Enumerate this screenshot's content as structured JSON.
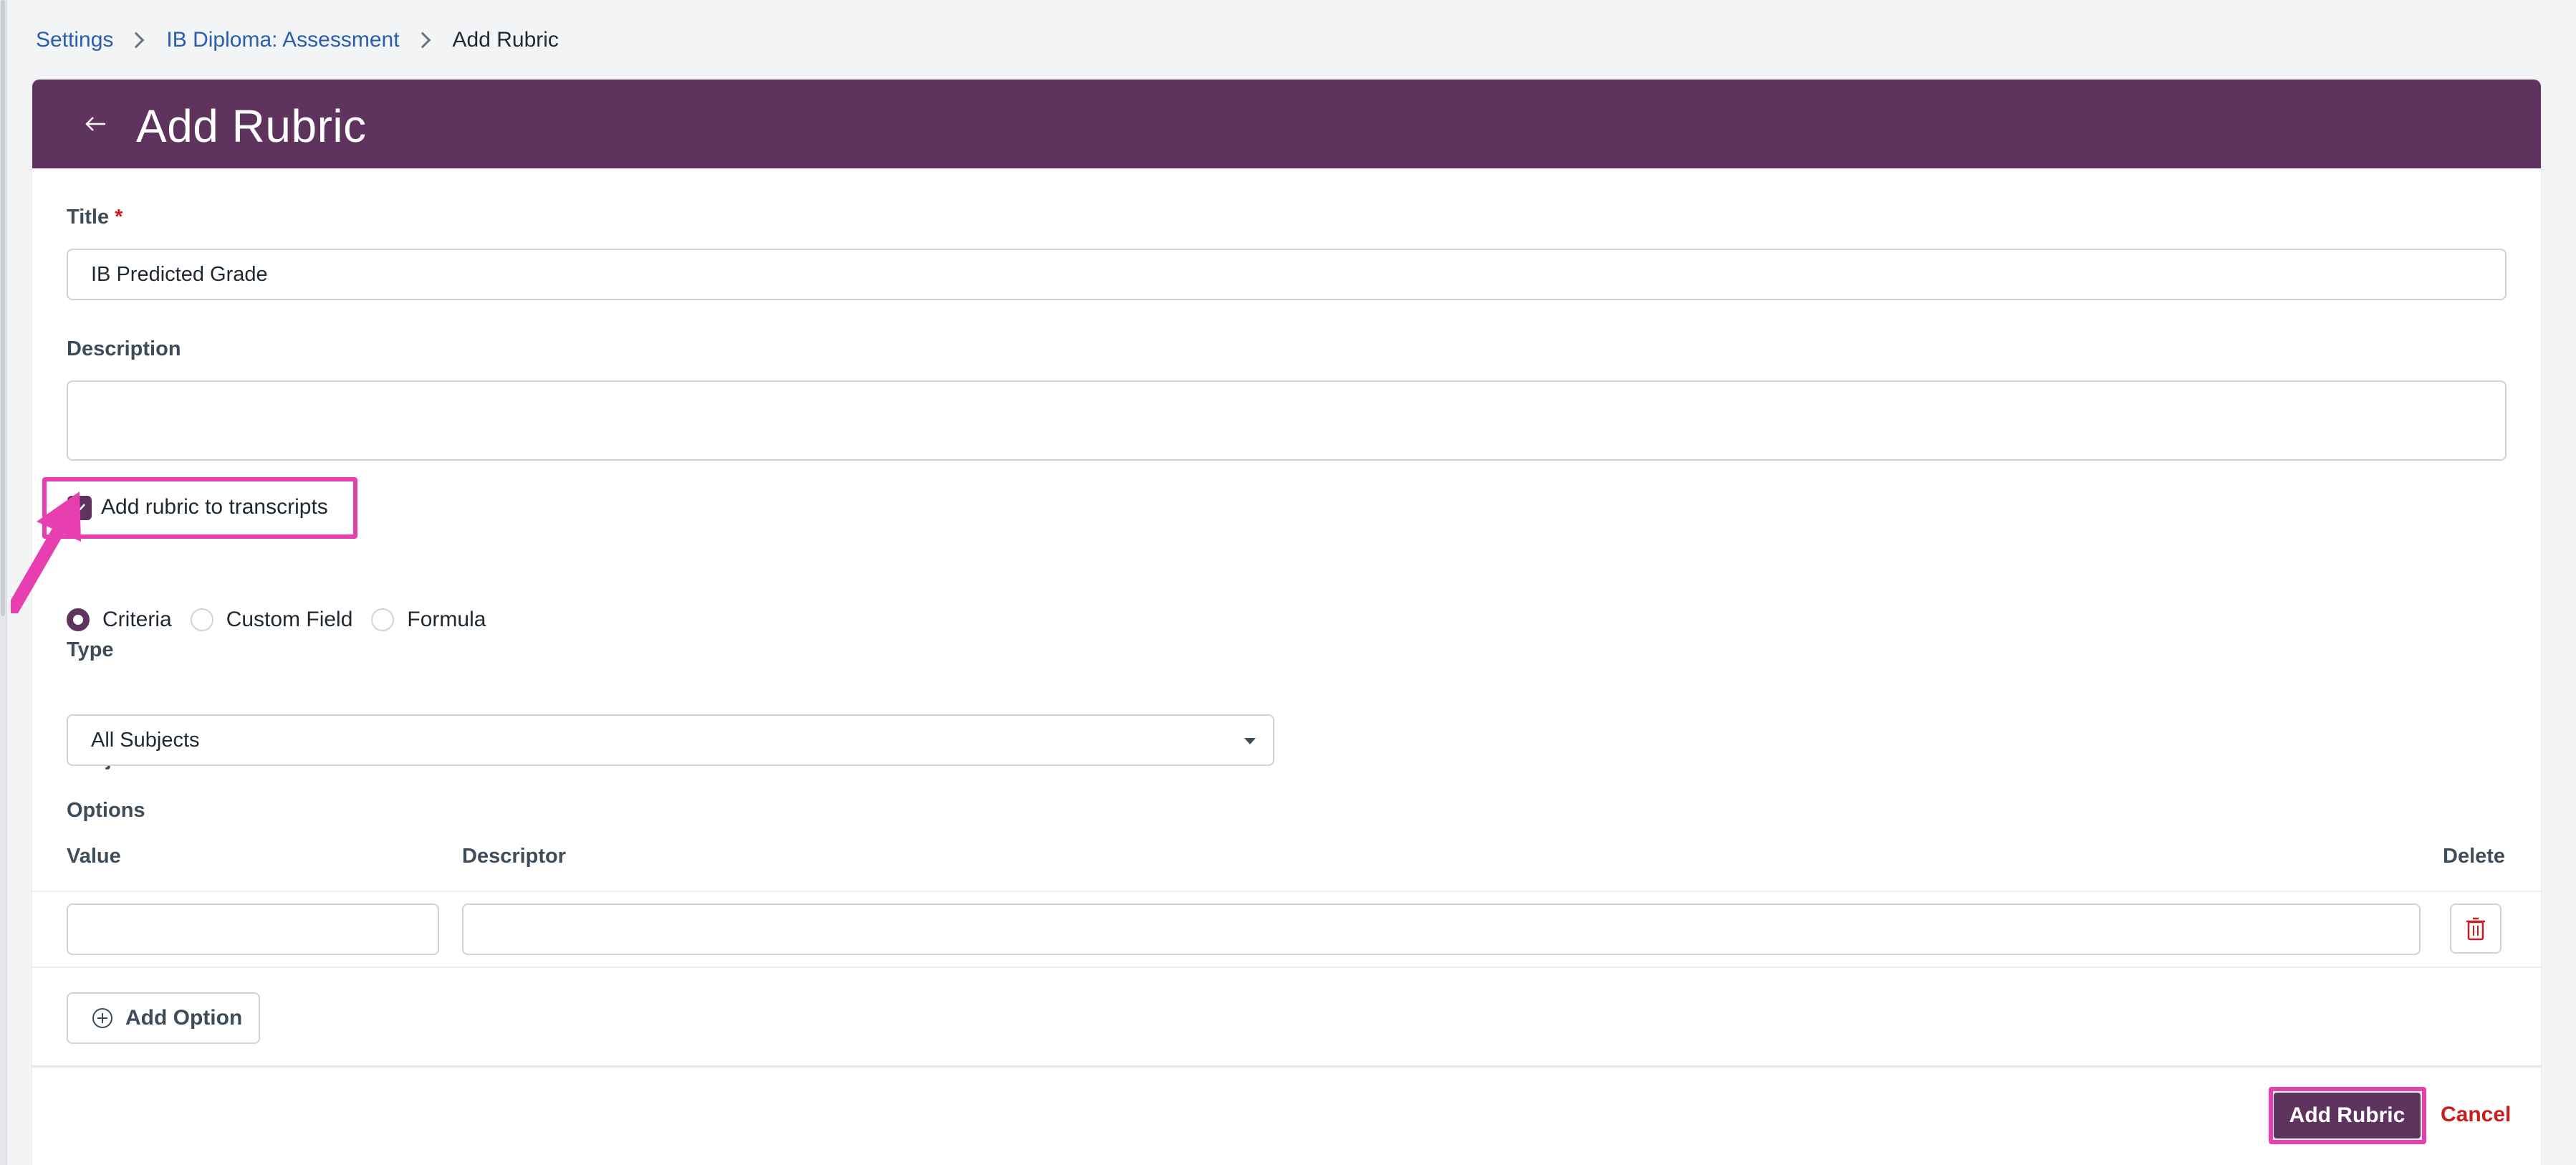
{
  "breadcrumb": {
    "items": [
      "Settings",
      "IB Diploma: Assessment",
      "Add Rubric"
    ]
  },
  "header": {
    "title": "Add Rubric",
    "back_icon": "arrow-left-icon"
  },
  "form": {
    "title_label": "Title",
    "required_mark": "*",
    "title_value": "IB Predicted Grade",
    "description_label": "Description",
    "description_value": "",
    "transcripts_checkbox": {
      "label": "Add rubric to transcripts",
      "checked": true
    },
    "type_label": "Type",
    "type_options": [
      {
        "label": "Criteria",
        "selected": true
      },
      {
        "label": "Custom Field",
        "selected": false
      },
      {
        "label": "Formula",
        "selected": false
      }
    ],
    "subject_label": "Subject",
    "subject_value": "All Subjects",
    "options_label": "Options",
    "options_columns": {
      "value": "Value",
      "descriptor": "Descriptor",
      "delete": "Delete"
    },
    "options_rows": [
      {
        "value": "",
        "descriptor": ""
      }
    ],
    "add_option_label": "Add Option"
  },
  "footer": {
    "submit_label": "Add Rubric",
    "cancel_label": "Cancel"
  },
  "colors": {
    "brand": "#5e345e",
    "link": "#2a5db0",
    "danger": "#c81e1e",
    "highlight": "#e83fb0"
  }
}
